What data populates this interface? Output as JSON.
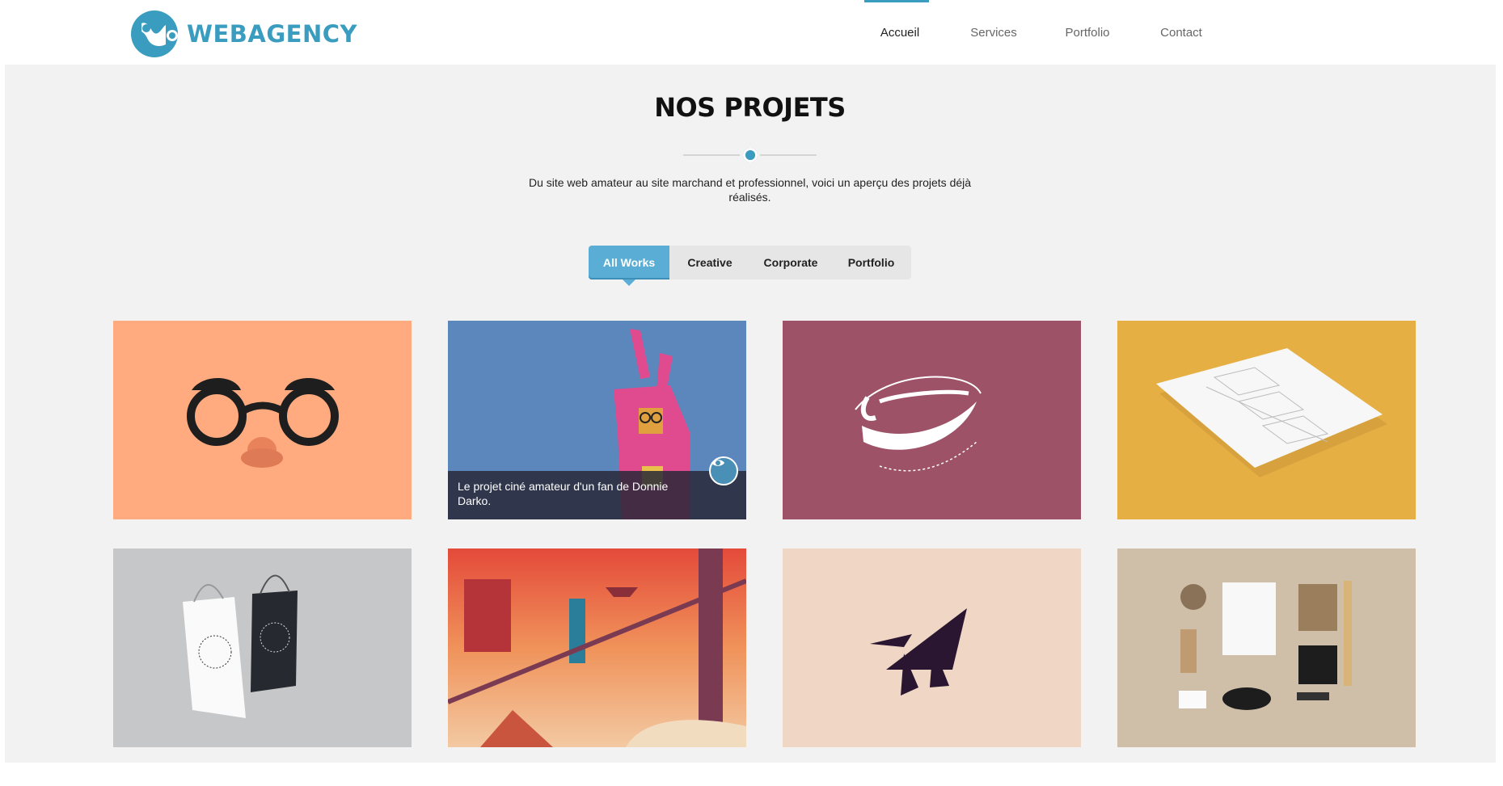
{
  "brand": {
    "name": "WEBAGENCY",
    "accent": "#3a9dbf"
  },
  "nav": {
    "items": [
      {
        "label": "Accueil",
        "active": true
      },
      {
        "label": "Services",
        "active": false
      },
      {
        "label": "Portfolio",
        "active": false
      },
      {
        "label": "Contact",
        "active": false
      }
    ]
  },
  "projects": {
    "title": "NOS PROJETS",
    "subtitle": "Du site web amateur au site marchand et professionnel, voici un aperçu des projets déjà réalisés.",
    "filters": [
      {
        "label": "All Works",
        "active": true
      },
      {
        "label": "Creative",
        "active": false
      },
      {
        "label": "Corporate",
        "active": false
      },
      {
        "label": "Portfolio",
        "active": false
      }
    ],
    "tiles": [
      {
        "art": "glasses-illustration",
        "bg": "#ffab7f"
      },
      {
        "art": "bunny-illustration",
        "bg": "#5c87bd",
        "caption": "Le projet ciné amateur d'un fan de Donnie Darko.",
        "icon": "eye-icon"
      },
      {
        "art": "pompadour-logo",
        "bg": "#9d5268"
      },
      {
        "art": "paper-mockup",
        "bg": "#e6af44"
      },
      {
        "art": "shopping-bags-mockup",
        "bg": "#c6c7c9"
      },
      {
        "art": "city-illustration",
        "bg": "#e85a3c"
      },
      {
        "art": "rocket-logo",
        "bg": "#efd6c5"
      },
      {
        "art": "stationery-mockup",
        "bg": "#cfbfa9"
      }
    ]
  }
}
